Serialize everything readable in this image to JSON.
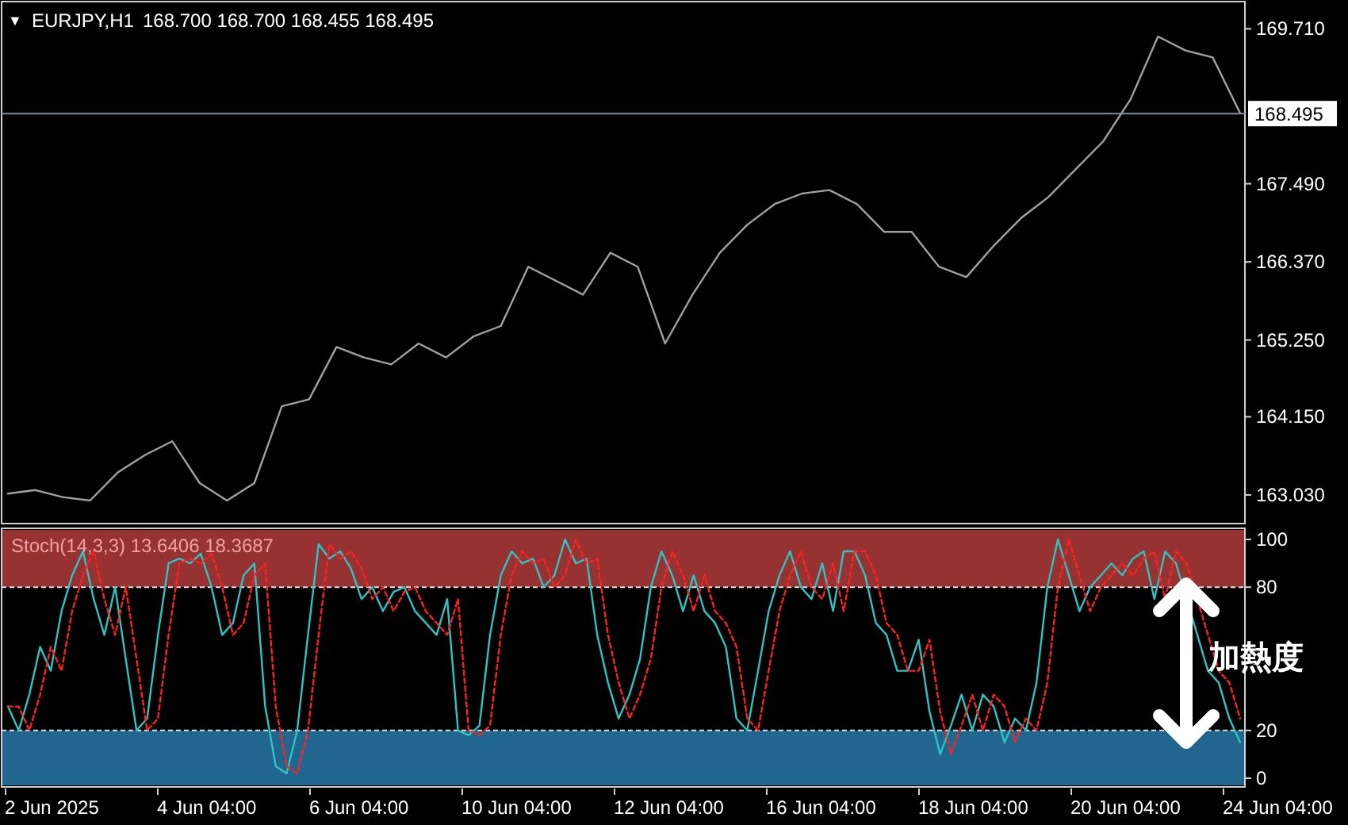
{
  "price_chart": {
    "menu_marker": "▼",
    "symbol": "EURJPY,H1",
    "ohlc": "168.700 168.700 168.455 168.495",
    "chart_data": {
      "type": "line",
      "ylim": [
        162.62,
        170.1
      ],
      "yticks": [
        {
          "value": 169.71,
          "label": "169.710"
        },
        {
          "value": 167.49,
          "label": "167.490"
        },
        {
          "value": 166.37,
          "label": "166.370"
        },
        {
          "value": 165.25,
          "label": "165.250"
        },
        {
          "value": 164.15,
          "label": "164.150"
        },
        {
          "value": 163.03,
          "label": "163.030"
        }
      ],
      "ref_lines": [
        {
          "axis": "y",
          "value": 168.495,
          "label": "168.495"
        }
      ],
      "series": [
        {
          "color": "#a0a0a0",
          "values": [
            163.05,
            163.1,
            163.0,
            162.95,
            163.35,
            163.6,
            163.8,
            163.2,
            162.95,
            163.2,
            164.3,
            164.4,
            165.15,
            165.0,
            164.9,
            165.2,
            165.0,
            165.3,
            165.45,
            166.3,
            166.1,
            165.9,
            166.5,
            166.3,
            165.2,
            165.9,
            166.5,
            166.9,
            167.2,
            167.35,
            167.4,
            167.2,
            166.8,
            166.8,
            166.3,
            166.15,
            166.6,
            167.0,
            167.3,
            167.7,
            168.1,
            168.7,
            169.6,
            169.4,
            169.3,
            168.5
          ]
        }
      ]
    }
  },
  "stochastic": {
    "label": "Stoch(14,3,3) 13.6406 18.3687",
    "annotation": {
      "text": "加熱度"
    },
    "chart_data": {
      "type": "line",
      "ylim": [
        -3,
        104
      ],
      "yticks": [
        100,
        80,
        20,
        0
      ],
      "bands": [
        {
          "axis": "y",
          "from": 80,
          "to": 104,
          "color": "#963232"
        },
        {
          "axis": "y",
          "from": -3,
          "to": 20,
          "color": "#20668f"
        }
      ],
      "ref_lines": [
        {
          "axis": "y",
          "value": 80
        },
        {
          "axis": "y",
          "value": 20
        }
      ],
      "series": [
        {
          "color": "#2ec4c4",
          "values": [
            30,
            20,
            35,
            55,
            45,
            70,
            85,
            95,
            75,
            60,
            80,
            50,
            20,
            25,
            60,
            90,
            92,
            90,
            94,
            80,
            60,
            65,
            85,
            90,
            30,
            5,
            2,
            20,
            60,
            98,
            92,
            95,
            88,
            75,
            80,
            70,
            78,
            80,
            70,
            65,
            60,
            75,
            20,
            18,
            22,
            60,
            85,
            95,
            90,
            92,
            80,
            85,
            100,
            90,
            92,
            60,
            40,
            25,
            35,
            50,
            80,
            95,
            85,
            70,
            85,
            70,
            65,
            55,
            25,
            20,
            45,
            70,
            85,
            95,
            80,
            75,
            90,
            70,
            95,
            95,
            85,
            65,
            60,
            45,
            45,
            58,
            28,
            10,
            22,
            35,
            20,
            35,
            30,
            15,
            25,
            20,
            40,
            80,
            100,
            85,
            70,
            80,
            85,
            90,
            85,
            92,
            95,
            75,
            95,
            90,
            75,
            60,
            45,
            40,
            25,
            15
          ]
        },
        {
          "color": "#ff2020",
          "line_style": "dashed",
          "values": [
            30,
            30,
            20,
            35,
            55,
            45,
            70,
            85,
            95,
            75,
            60,
            80,
            50,
            20,
            25,
            60,
            90,
            92,
            90,
            94,
            80,
            60,
            65,
            85,
            90,
            30,
            5,
            2,
            20,
            60,
            98,
            92,
            95,
            88,
            75,
            80,
            70,
            78,
            80,
            70,
            65,
            60,
            75,
            20,
            18,
            22,
            60,
            85,
            95,
            90,
            92,
            80,
            85,
            100,
            90,
            92,
            60,
            40,
            25,
            35,
            50,
            80,
            95,
            85,
            70,
            85,
            70,
            65,
            55,
            25,
            20,
            45,
            70,
            85,
            95,
            80,
            75,
            90,
            70,
            95,
            95,
            85,
            65,
            60,
            45,
            45,
            58,
            28,
            10,
            22,
            35,
            20,
            35,
            30,
            15,
            25,
            20,
            40,
            80,
            100,
            85,
            70,
            80,
            85,
            90,
            85,
            92,
            95,
            75,
            95,
            90,
            75,
            60,
            45,
            40,
            25
          ]
        }
      ]
    }
  },
  "time_axis": [
    "2 Jun 2025",
    "4 Jun 04:00",
    "6 Jun 04:00",
    "10 Jun 04:00",
    "12 Jun 04:00",
    "16 Jun 04:00",
    "18 Jun 04:00",
    "20 Jun 04:00",
    "24 Jun 04:00"
  ]
}
